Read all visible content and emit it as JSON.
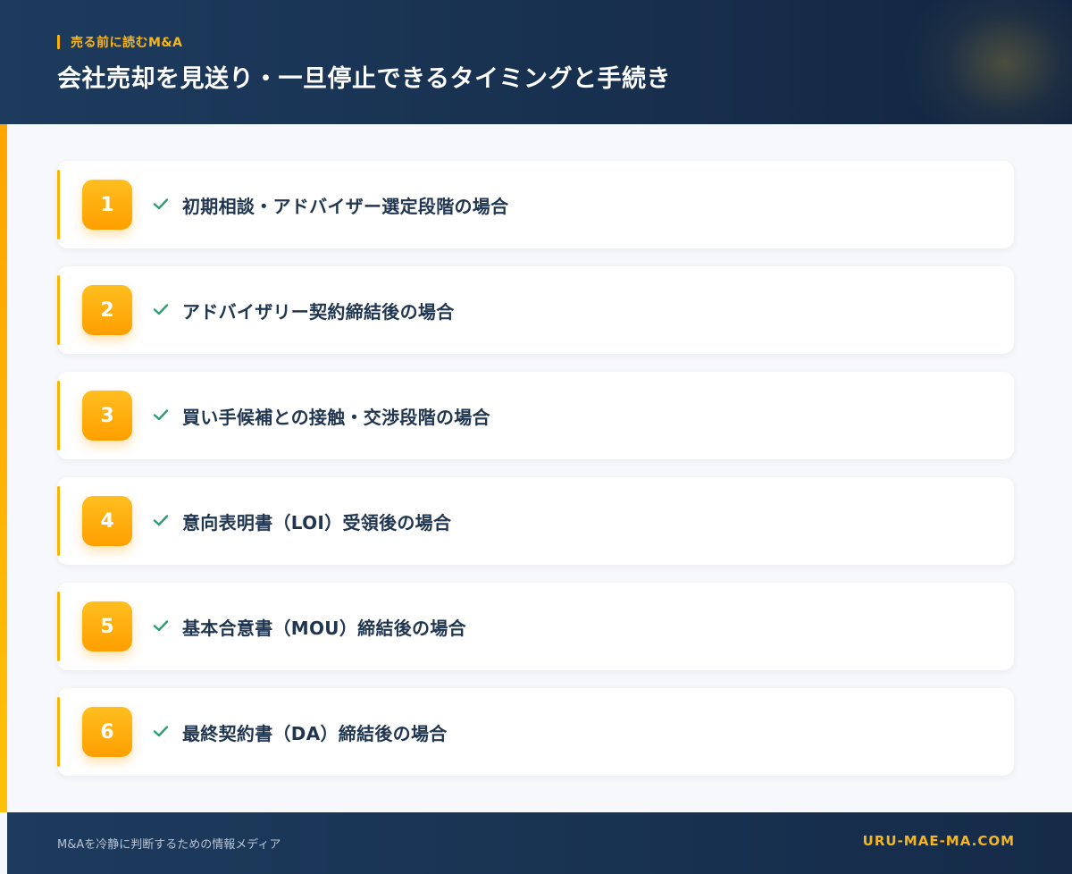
{
  "header": {
    "eyebrow": "売る前に読むM&A",
    "title": "会社売却を見送り・一旦停止できるタイミングと手続き"
  },
  "items": [
    {
      "number": "1",
      "label": "初期相談・アドバイザー選定段階の場合"
    },
    {
      "number": "2",
      "label": "アドバイザリー契約締結後の場合"
    },
    {
      "number": "3",
      "label": "買い手候補との接触・交渉段階の場合"
    },
    {
      "number": "4",
      "label": "意向表明書（LOI）受領後の場合"
    },
    {
      "number": "5",
      "label": "基本合意書（MOU）締結後の場合"
    },
    {
      "number": "6",
      "label": "最終契約書（DA）締結後の場合"
    }
  ],
  "footer": {
    "tagline": "M&Aを冷静に判断するための情報メディア",
    "site": "URU-MAE-MA.COM"
  },
  "colors": {
    "accent": "#ffb300",
    "navy": "#1d3b5e",
    "check": "#2e9e72",
    "text": "#1f3550"
  },
  "icons": {
    "item_marker": "check-icon"
  }
}
